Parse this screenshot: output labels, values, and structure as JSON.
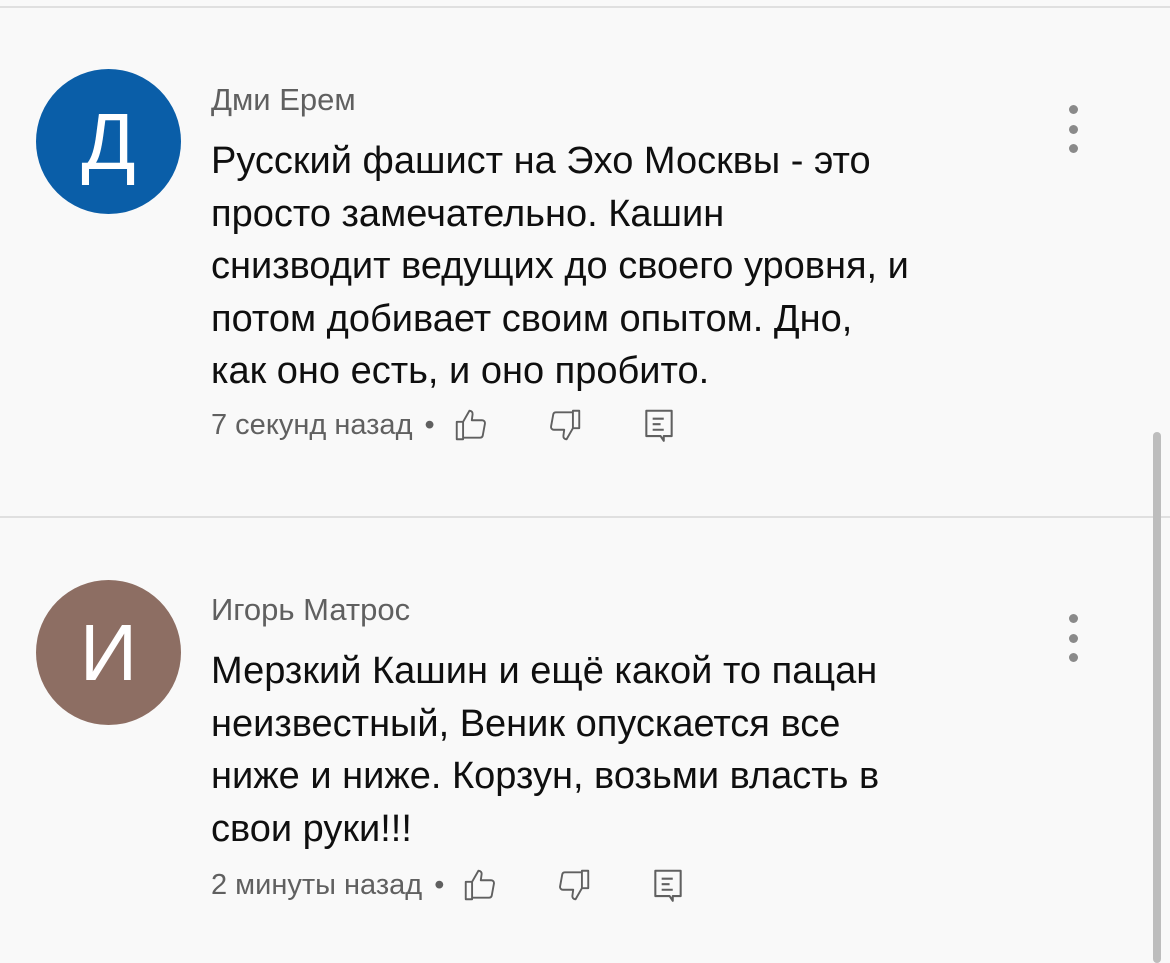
{
  "comments": [
    {
      "avatar_letter": "Д",
      "avatar_color": "#0a5ea8",
      "author": "Дми Ерем",
      "text": "Русский фашист на Эхо Москвы - это\nпросто замечательно. Кашин\nснизводит ведущих до своего уровня, и\nпотом добивает своим опытом. Дно,\nкак оно есть, и оно пробито.",
      "time": "7 секунд назад"
    },
    {
      "avatar_letter": "И",
      "avatar_color": "#8d6e63",
      "author": "Игорь Матрос",
      "text": "Мерзкий Кашин и ещё какой то пацан\nнеизвестный, Веник опускается все\nниже и ниже. Корзун, возьми власть в\nсвои руки!!!",
      "time": "2 минуты назад"
    }
  ],
  "meta_separator": "•",
  "icons": {
    "like": "thumbs-up-icon",
    "dislike": "thumbs-down-icon",
    "reply": "reply-icon",
    "menu": "more-vert-icon"
  }
}
